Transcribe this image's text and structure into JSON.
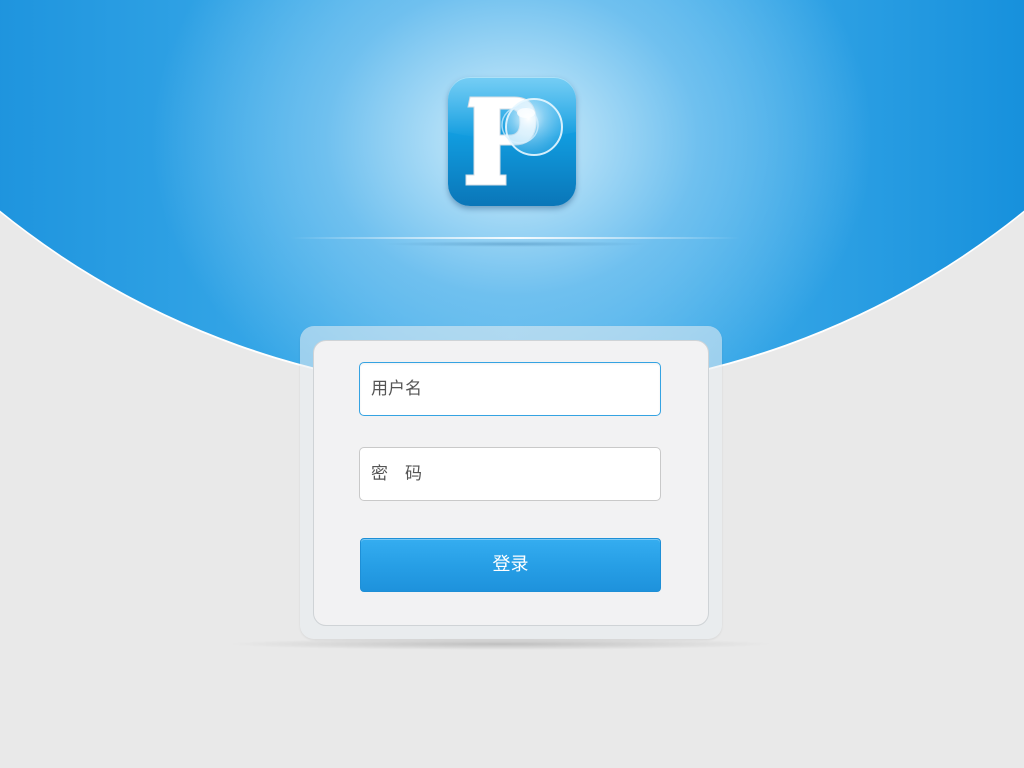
{
  "app": {
    "logo_icon": "p-letter-bubble-icon",
    "colors": {
      "brand_blue": "#1e94de",
      "button_blue": "#279fe6",
      "background": "#e9e9e9"
    }
  },
  "login_form": {
    "username": {
      "placeholder": "用户名",
      "value": ""
    },
    "password": {
      "placeholder": "密　码",
      "value": ""
    },
    "submit_label": "登录"
  }
}
